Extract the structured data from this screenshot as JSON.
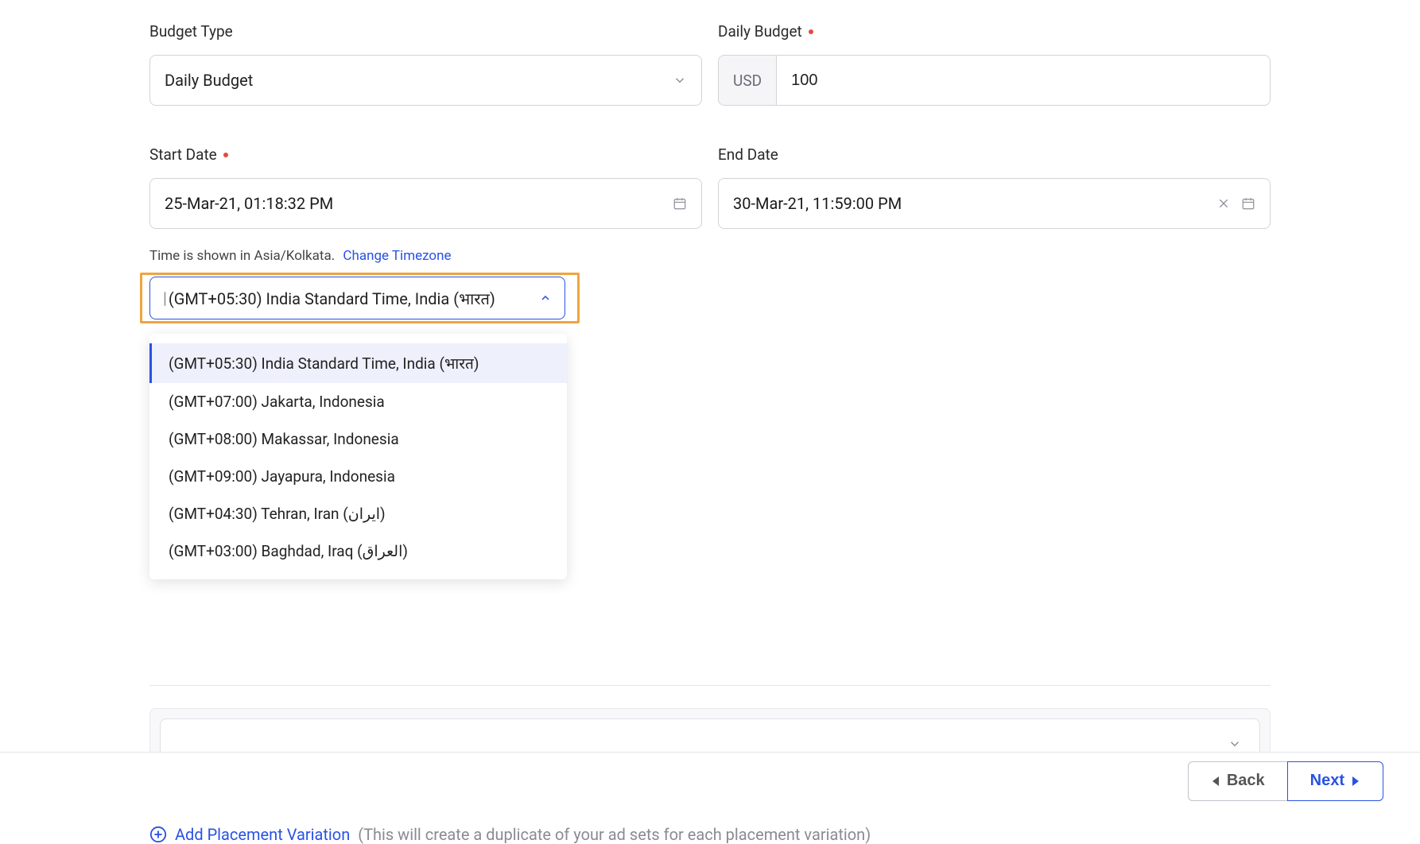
{
  "budget_type": {
    "label": "Budget Type",
    "value": "Daily Budget"
  },
  "daily_budget": {
    "label": "Daily Budget",
    "currency": "USD",
    "value": "100"
  },
  "start_date": {
    "label": "Start Date",
    "value": "25-Mar-21, 01:18:32 PM"
  },
  "end_date": {
    "label": "End Date",
    "value": "30-Mar-21, 11:59:00 PM"
  },
  "timezone": {
    "note_prefix": "Time is shown in Asia/Kolkata.",
    "change_link": "Change Timezone",
    "selected": "(GMT+05:30) India Standard Time, India (भारत)",
    "options": [
      "(GMT+05:30) India Standard Time, India (भारत)",
      "(GMT+07:00) Jakarta, Indonesia",
      "(GMT+08:00) Makassar, Indonesia",
      "(GMT+09:00) Jayapura, Indonesia",
      "(GMT+04:30) Tehran, Iran (ایران)",
      "(GMT+03:00) Baghdad, Iraq (العراق)"
    ]
  },
  "placement": {
    "add_link": "Add Placement Variation",
    "hint": "(This will create a duplicate of your ad sets for each placement variation)"
  },
  "footer": {
    "back": "Back",
    "next": "Next"
  }
}
